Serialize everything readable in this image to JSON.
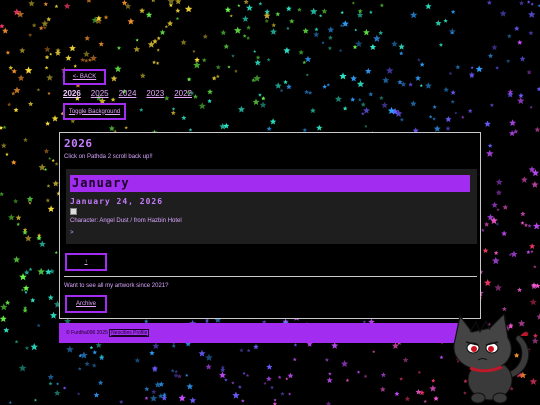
{
  "nav": {
    "back_label": "<- BACK",
    "years": [
      "2026",
      "2025",
      "2024",
      "2023",
      "2022"
    ],
    "active_year": "2026",
    "toggle_label": "Toggle Background"
  },
  "panel": {
    "year_title": "2026",
    "scroll_note": "Click on Pathda 2 scroll back up!!",
    "month_title": "January",
    "entry_date": "January 24, 2026",
    "character_line": "Character: Angel Dust / from Hazbin Hotel",
    "expand_arrow": ">",
    "up_label": "↑",
    "see_all": "Want to see all my artwork since 2021?",
    "archive_label": "Archive"
  },
  "footer": {
    "copyright": "© Furdha096 2025",
    "profile_link": "Neocities Profile"
  },
  "colors": {
    "accent": "#a22cf0",
    "text": "#e0b3ff",
    "background": "#000000",
    "month_box": "#1e1e1e"
  },
  "icons": {
    "broken_image": "broken-image-icon",
    "mascot": "cat-mascot-icon",
    "background_pattern": "rainbow-stars"
  }
}
